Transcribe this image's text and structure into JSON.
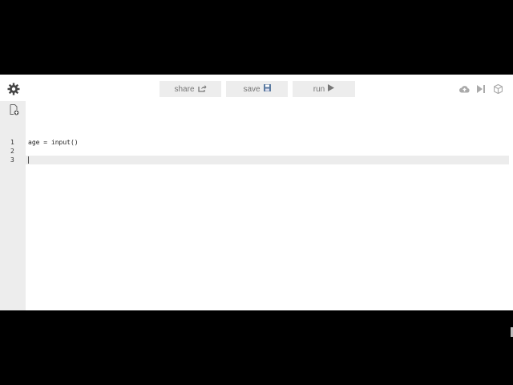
{
  "toolbar": {
    "share_label": "share",
    "save_label": "save",
    "run_label": "run"
  },
  "gutter": {
    "line_numbers": [
      "1",
      "2",
      "3"
    ]
  },
  "editor": {
    "lines": [
      "age = input()",
      "",
      ""
    ],
    "active_line": 3
  },
  "icons": {
    "settings": "gear-icon",
    "new_file": "new-file-icon",
    "share": "share-icon",
    "save": "save-icon",
    "run": "play-icon",
    "upload": "cloud-upload-icon",
    "step": "step-forward-icon",
    "package": "cube-icon"
  },
  "colors": {
    "button_bg": "#ededed",
    "gutter_bg": "#ededed",
    "active_line_bg": "#ececec",
    "icon_gray": "#aaaaaa"
  }
}
